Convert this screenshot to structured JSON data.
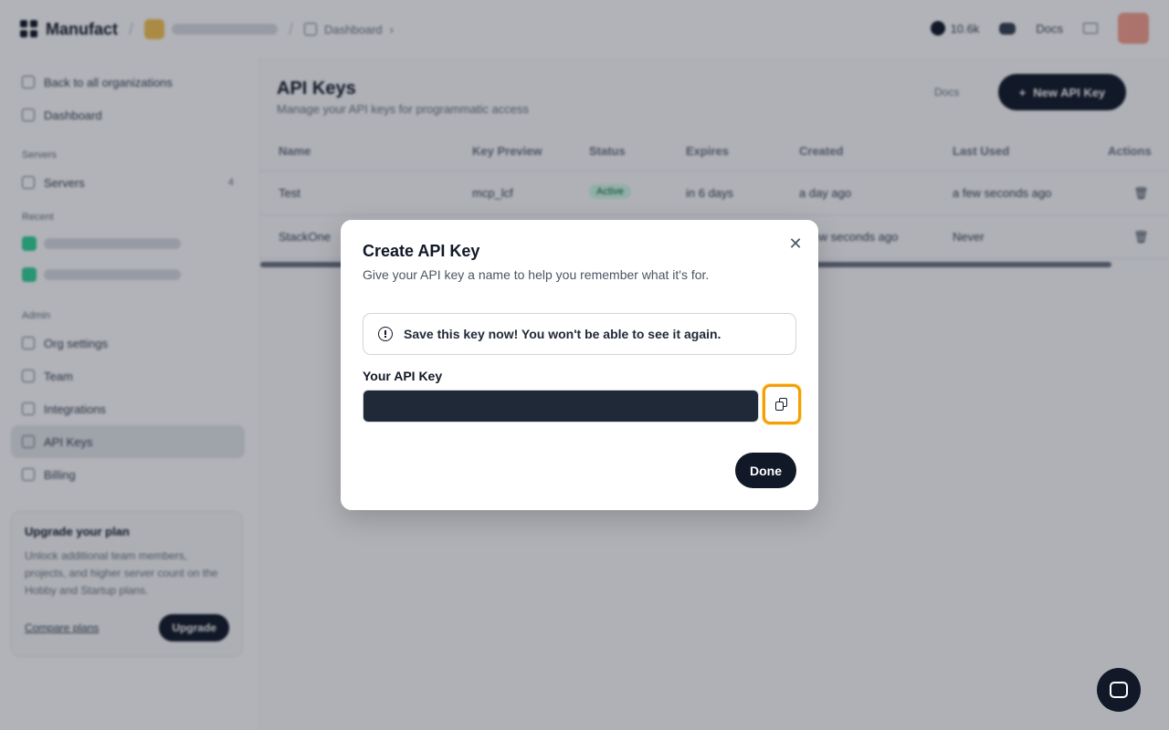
{
  "topbar": {
    "brand": "Manufact",
    "breadcrumb": "Dashboard",
    "github_stars": "10.6k",
    "docs": "Docs"
  },
  "sidebar": {
    "back": "Back to all organizations",
    "dashboard": "Dashboard",
    "servers_head": "Servers",
    "servers": "Servers",
    "servers_count": "4",
    "recent_head": "Recent",
    "admin_head": "Admin",
    "org_settings": "Org settings",
    "team": "Team",
    "integrations": "Integrations",
    "api_keys": "API Keys",
    "billing": "Billing"
  },
  "upgrade": {
    "title": "Upgrade your plan",
    "body": "Unlock additional team members, projects, and higher server count on the Hobby and Startup plans.",
    "compare": "Compare plans",
    "button": "Upgrade"
  },
  "main": {
    "title": "API Keys",
    "subtitle": "Manage your API keys for programmatic access",
    "docs": "Docs",
    "new_button": "New API Key",
    "columns": [
      "Name",
      "Key Preview",
      "Status",
      "Expires",
      "Created",
      "Last Used",
      "Actions"
    ],
    "rows": [
      {
        "name": "Test",
        "preview": "mcp_lcf",
        "status": "Active",
        "expires": "in 6 days",
        "created": "a day ago",
        "last_used": "a few seconds ago"
      },
      {
        "name": "StackOne",
        "preview": "",
        "status": "",
        "expires": "",
        "created": "a few seconds ago",
        "last_used": "Never"
      }
    ]
  },
  "modal": {
    "title": "Create API Key",
    "description": "Give your API key a name to help you remember what it's for.",
    "alert": "Save this key now! You won't be able to see it again.",
    "key_label": "Your API Key",
    "key_value": "",
    "done": "Done"
  },
  "colors": {
    "accent": "#111827",
    "focus_ring": "#f59e0b",
    "overlay": "rgba(17,24,39,0.33)"
  }
}
